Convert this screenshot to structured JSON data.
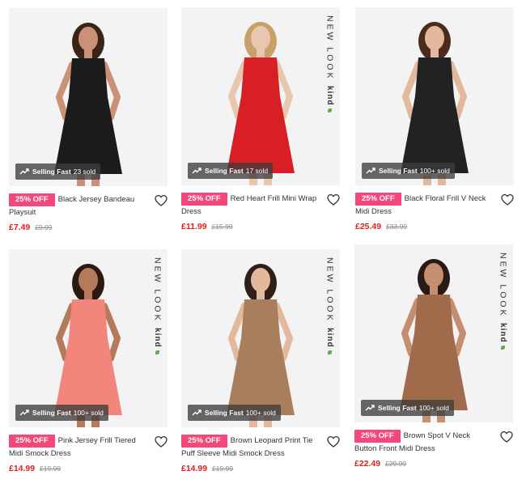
{
  "brand_mark": {
    "line1": "NEW LOOK",
    "line2": "kind"
  },
  "products": [
    {
      "discount": "25% OFF",
      "name": "Black Jersey Bandeau Playsuit",
      "price": "£7.49",
      "was": "£9.99",
      "selling_label": "Selling Fast",
      "sold": "23 sold",
      "kind_mark": false,
      "colors": {
        "bg": "#f3f3f3",
        "garment": "#1b1b1b",
        "skin": "#c99176",
        "hair": "#3a2418"
      }
    },
    {
      "discount": "25% OFF",
      "name": "Red Heart Frill Mini Wrap Dress",
      "price": "£11.99",
      "was": "£15.99",
      "selling_label": "Selling Fast",
      "sold": "17 sold",
      "kind_mark": true,
      "colors": {
        "bg": "#f3f3f3",
        "garment": "#d81f26",
        "skin": "#e9c6ae",
        "hair": "#caa06a"
      }
    },
    {
      "discount": "25% OFF",
      "name": "Black Floral Frill V Neck Midi Dress",
      "price": "£25.49",
      "was": "£33.99",
      "selling_label": "Selling Fast",
      "sold": "100+ sold",
      "kind_mark": false,
      "colors": {
        "bg": "#f3f3f3",
        "garment": "#222222",
        "skin": "#e3b89c",
        "hair": "#4a2c1c"
      }
    },
    {
      "discount": "25% OFF",
      "name": "Pink Jersey Frill Tiered Midi Smock Dress",
      "price": "£14.99",
      "was": "£19.99",
      "selling_label": "Selling Fast",
      "sold": "100+ sold",
      "kind_mark": true,
      "colors": {
        "bg": "#f3f3f3",
        "garment": "#f2867c",
        "skin": "#b57a5c",
        "hair": "#2a1a12"
      }
    },
    {
      "discount": "25% OFF",
      "name": "Brown Leopard Print Tie Puff Sleeve Midi Smock Dress",
      "price": "£14.99",
      "was": "£19.99",
      "selling_label": "Selling Fast",
      "sold": "100+ sold",
      "kind_mark": true,
      "colors": {
        "bg": "#f3f3f3",
        "garment": "#a97e5c",
        "skin": "#e2b99c",
        "hair": "#2e2018"
      }
    },
    {
      "discount": "25% OFF",
      "name": "Brown Spot V Neck Button Front Midi Dress",
      "price": "£22.49",
      "was": "£29.99",
      "selling_label": "Selling Fast",
      "sold": "100+ sold",
      "kind_mark": true,
      "colors": {
        "bg": "#f3f3f3",
        "garment": "#a06b4b",
        "skin": "#c48f70",
        "hair": "#2a1a14"
      }
    }
  ],
  "icons": {
    "wishlist": "heart-outline-icon",
    "trend": "trend-up-icon"
  },
  "accent": {
    "pill": "#f5477a",
    "price": "#e0201b"
  }
}
